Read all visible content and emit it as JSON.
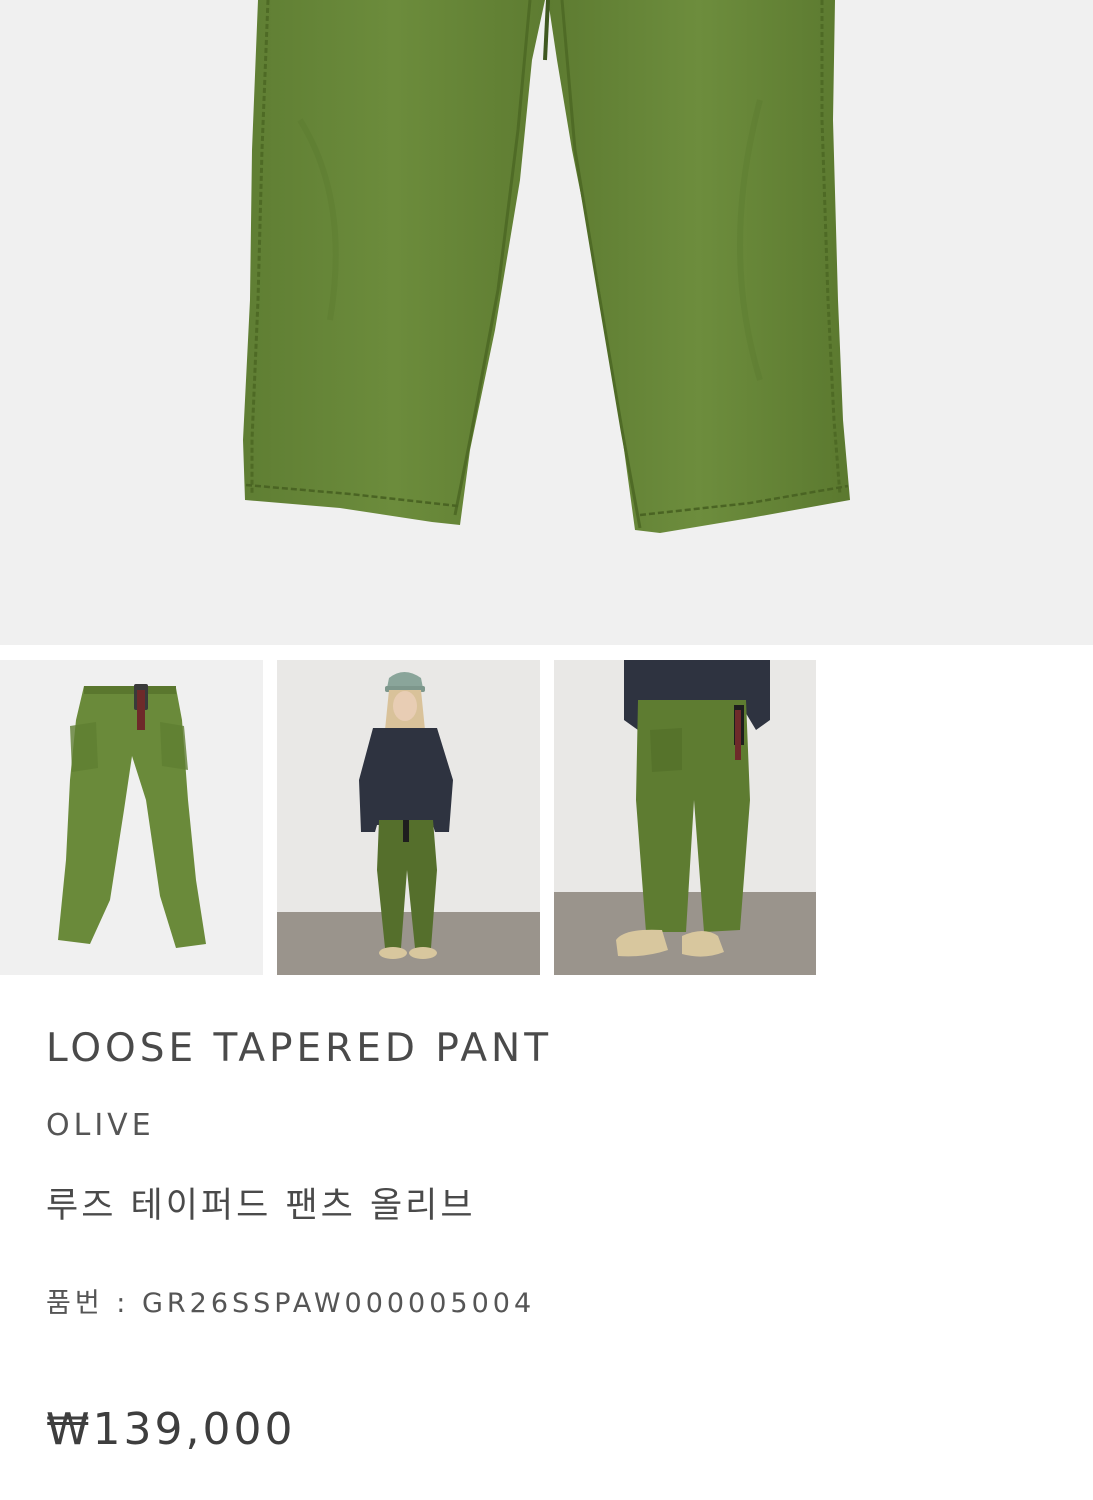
{
  "product": {
    "name": "LOOSE TAPERED PANT",
    "color_name": "OLIVE",
    "korean_name": "루즈 테이퍼드 팬츠 올리브",
    "code_label": "품번",
    "code_separator": " : ",
    "code_value": "GR26SSPAW000005004",
    "price": "₩139,000"
  },
  "colors": {
    "olive": "#6a8a3a",
    "olive_dark": "#556f2c",
    "hero_bg": "#f0f0f0",
    "studio_wall": "#e9e8e6",
    "studio_floor": "#9a948c"
  },
  "gallery": {
    "thumbnails": [
      "flat-lay",
      "model-full-body",
      "model-lower-body"
    ]
  }
}
